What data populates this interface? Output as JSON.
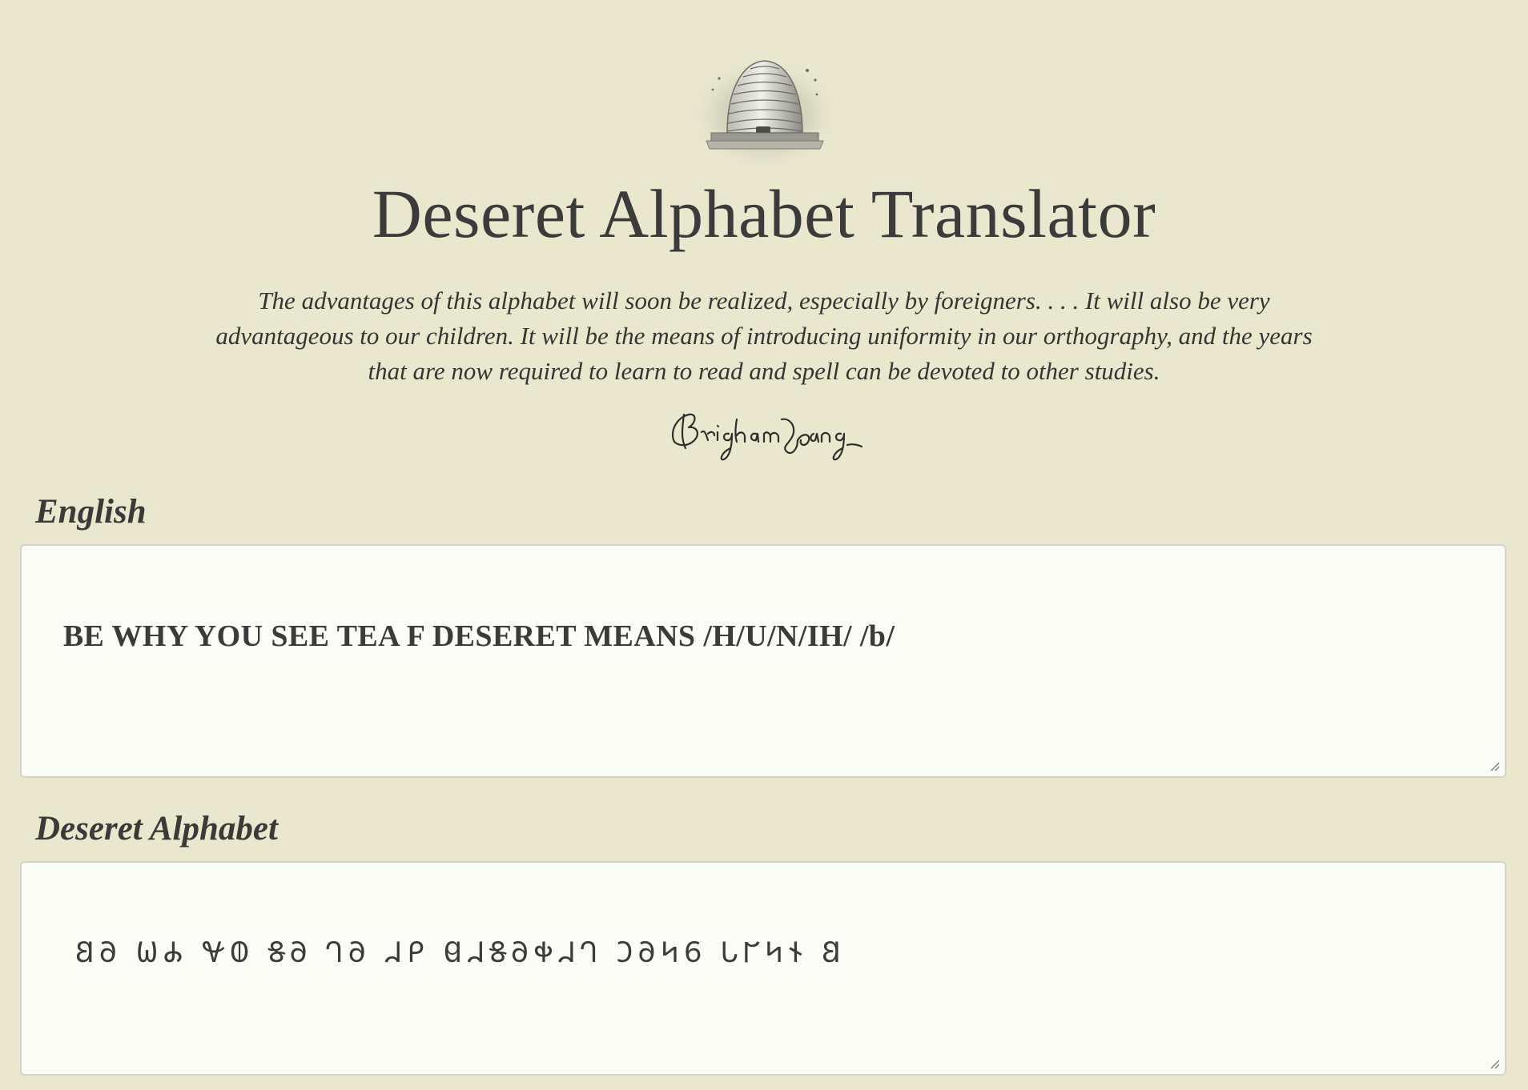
{
  "header": {
    "logo": "beehive-emblem",
    "title": "Deseret Alphabet Translator",
    "quote": "The advantages of this alphabet will soon be realized, especially by foreigners. . . . It will also be very advantageous to our children. It will be the means of introducing uniformity in our orthography, and the years that are now required to learn to read and spell can be devoted to other studies.",
    "signature": "Brigham Young"
  },
  "english": {
    "label": "English",
    "value": "BE WHY YOU SEE TEA F DESERET MEANS /H/U/N/IH/ /b/"
  },
  "deseret": {
    "label": "Deseret Alphabet",
    "value": "𐐒𐐀 𐐎𐐌 𐐏𐐅 𐐝𐐀 𐐓𐐀 𐐇𐐙 𐐔𐐇𐐝𐐀𐐡𐐇𐐓 𐐣𐐀𐐤𐐞 𐐢𐐊𐐤𐐆 𐐒"
  },
  "colors": {
    "background": "#e9e7cd",
    "textbox": "#fbfcf5",
    "text": "#3b3b3b"
  }
}
